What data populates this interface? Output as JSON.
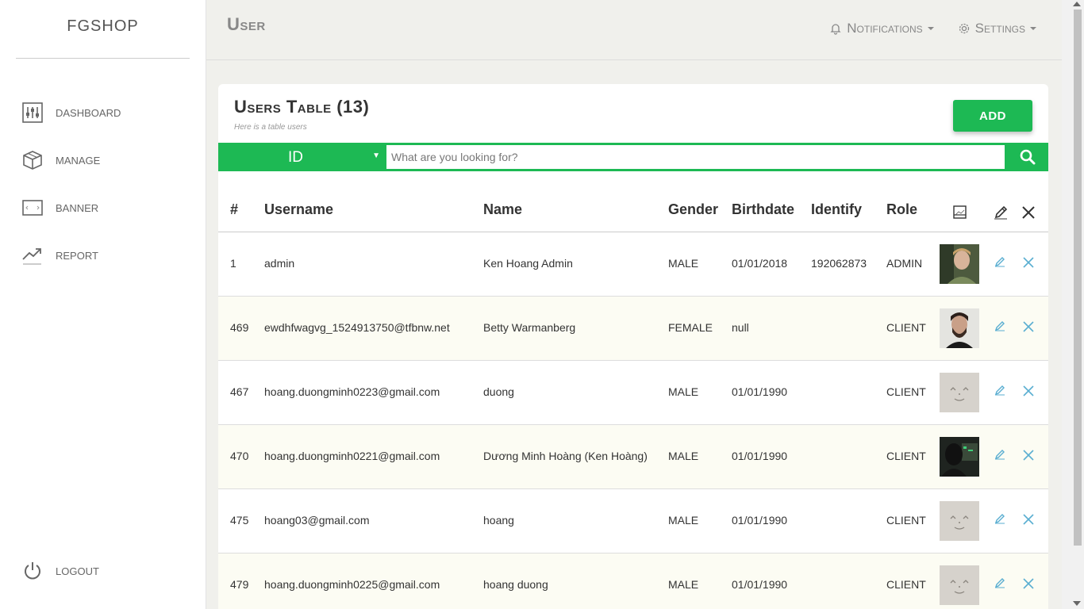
{
  "sidebar": {
    "brand": "FGSHOP",
    "items": [
      {
        "label": "DASHBOARD",
        "icon": "sliders-icon"
      },
      {
        "label": "MANAGE",
        "icon": "box-icon"
      },
      {
        "label": "BANNER",
        "icon": "banner-icon"
      },
      {
        "label": "REPORT",
        "icon": "trending-up-icon"
      }
    ],
    "logout": "LOGOUT"
  },
  "header": {
    "title": "User",
    "notifications": "Notifications",
    "settings": "Settings"
  },
  "card": {
    "title": "Users Table (13)",
    "subtitle": "Here is a table users",
    "add_label": "ADD"
  },
  "search": {
    "field": "ID",
    "placeholder": "What are you looking for?"
  },
  "colors": {
    "accent": "#1db954",
    "icon_blue": "#5aaed1"
  },
  "table": {
    "columns": [
      "#",
      "Username",
      "Name",
      "Gender",
      "Birthdate",
      "Identify",
      "Role"
    ],
    "rows": [
      {
        "id": "1",
        "username": "admin",
        "name": "Ken Hoang Admin",
        "gender": "MALE",
        "birthdate": "01/01/2018",
        "identify": "192062873",
        "role": "ADMIN",
        "avatar": "photo-man-blond"
      },
      {
        "id": "469",
        "username": "ewdhfwagvg_1524913750@tfbnw.net",
        "name": "Betty Warmanberg",
        "gender": "FEMALE",
        "birthdate": "null",
        "identify": "",
        "role": "CLIENT",
        "avatar": "photo-man-beard"
      },
      {
        "id": "467",
        "username": "hoang.duongminh0223@gmail.com",
        "name": "duong",
        "gender": "MALE",
        "birthdate": "01/01/1990",
        "identify": "",
        "role": "CLIENT",
        "avatar": "default-face"
      },
      {
        "id": "470",
        "username": "hoang.duongminh0221@gmail.com",
        "name": "Dương Minh Hoàng (Ken Hoàng)",
        "gender": "MALE",
        "birthdate": "01/01/1990",
        "identify": "",
        "role": "CLIENT",
        "avatar": "photo-hoodie-computer"
      },
      {
        "id": "475",
        "username": "hoang03@gmail.com",
        "name": "hoang",
        "gender": "MALE",
        "birthdate": "01/01/1990",
        "identify": "",
        "role": "CLIENT",
        "avatar": "default-face"
      },
      {
        "id": "479",
        "username": "hoang.duongminh0225@gmail.com",
        "name": "hoang duong",
        "gender": "MALE",
        "birthdate": "01/01/1990",
        "identify": "",
        "role": "CLIENT",
        "avatar": "default-face"
      }
    ]
  }
}
